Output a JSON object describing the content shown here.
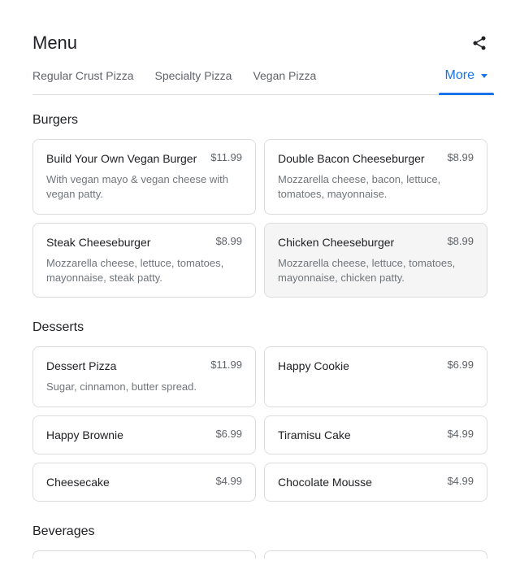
{
  "header": {
    "title": "Menu"
  },
  "tabs": {
    "items": [
      "Regular Crust Pizza",
      "Specialty Pizza",
      "Vegan Pizza"
    ],
    "more": "More"
  },
  "sections": {
    "burgers": {
      "title": "Burgers",
      "items": [
        {
          "name": "Build Your Own Vegan Burger",
          "price": "$11.99",
          "desc": "With vegan mayo & vegan cheese with vegan patty."
        },
        {
          "name": "Double Bacon Cheeseburger",
          "price": "$8.99",
          "desc": "Mozzarella cheese, bacon, lettuce, tomatoes, mayonnaise."
        },
        {
          "name": "Steak Cheeseburger",
          "price": "$8.99",
          "desc": "Mozzarella cheese, lettuce, tomatoes, mayonnaise, steak patty."
        },
        {
          "name": "Chicken Cheeseburger",
          "price": "$8.99",
          "desc": "Mozzarella cheese, lettuce, tomatoes, mayonnaise, chicken patty."
        }
      ]
    },
    "desserts": {
      "title": "Desserts",
      "items": [
        {
          "name": "Dessert Pizza",
          "price": "$11.99",
          "desc": "Sugar, cinnamon, butter spread."
        },
        {
          "name": "Happy Cookie",
          "price": "$6.99",
          "desc": ""
        },
        {
          "name": "Happy Brownie",
          "price": "$6.99",
          "desc": ""
        },
        {
          "name": "Tiramisu Cake",
          "price": "$4.99",
          "desc": ""
        },
        {
          "name": "Cheesecake",
          "price": "$4.99",
          "desc": ""
        },
        {
          "name": "Chocolate Mousse",
          "price": "$4.99",
          "desc": ""
        }
      ]
    },
    "beverages": {
      "title": "Beverages"
    }
  }
}
